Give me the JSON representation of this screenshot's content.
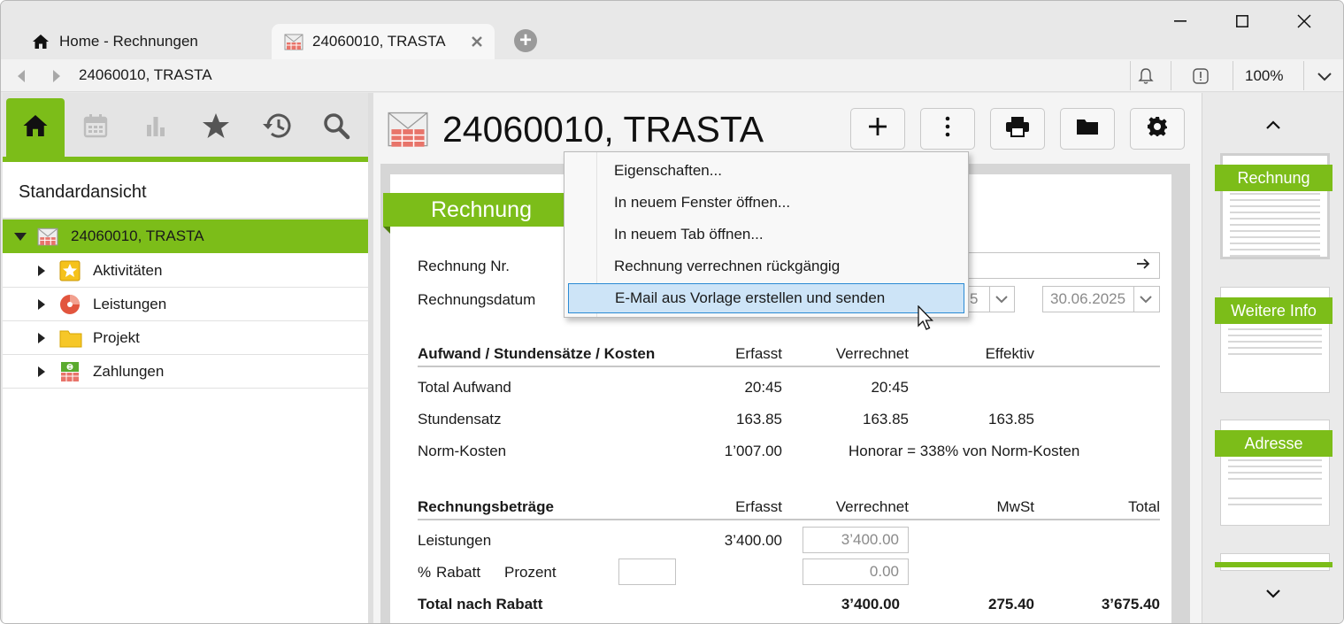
{
  "titlebar": {
    "tabs": [
      {
        "label": "Home - Rechnungen",
        "icon": "home-icon"
      },
      {
        "label": "24060010, TRASTA",
        "icon": "invoice-envelope-icon",
        "active": true
      }
    ]
  },
  "address": {
    "text": "24060010, TRASTA",
    "zoom": "100%"
  },
  "left_panel": {
    "view_title": "Standardansicht",
    "tree_root": "24060010, TRASTA",
    "tree_items": [
      {
        "label": "Aktivitäten",
        "icon": "activities-star-icon"
      },
      {
        "label": "Leistungen",
        "icon": "services-pie-icon"
      },
      {
        "label": "Projekt",
        "icon": "folder-icon"
      },
      {
        "label": "Zahlungen",
        "icon": "payments-icon"
      }
    ]
  },
  "main": {
    "title": "24060010, TRASTA",
    "section_banner": "Rechnung",
    "invoice_no_label": "Rechnung Nr.",
    "invoice_date_label": "Rechnungsdatum",
    "date_value_partial": "5",
    "date_value": "30.06.2025",
    "effort": {
      "headers": [
        "Aufwand / Stundensätze / Kosten",
        "Erfasst",
        "Verrechnet",
        "Effektiv"
      ],
      "rows": [
        {
          "label": "Total Aufwand",
          "erfasst": "20:45",
          "verrechnet": "20:45",
          "effektiv": ""
        },
        {
          "label": "Stundensatz",
          "erfasst": "163.85",
          "verrechnet": "163.85",
          "effektiv": "163.85"
        },
        {
          "label": "Norm-Kosten",
          "erfasst": "1’007.00",
          "note": "Honorar = 338% von Norm-Kosten"
        }
      ]
    },
    "amounts": {
      "headers": [
        "Rechnungsbeträge",
        "Erfasst",
        "Verrechnet",
        "MwSt",
        "Total"
      ],
      "leistungen_label": "Leistungen",
      "leistungen_erfasst": "3’400.00",
      "leistungen_verrechnet": "3’400.00",
      "rabatt_symbol": "%",
      "rabatt_label": "Rabatt",
      "prozent_label": "Prozent",
      "rabatt_value": "0.00",
      "total_label": "Total nach Rabatt",
      "total_verrechnet": "3’400.00",
      "total_mwst": "275.40",
      "total_total": "3’675.40"
    }
  },
  "context_menu": {
    "items": [
      "Eigenschaften...",
      "In neuem Fenster öffnen...",
      "In neuem Tab öffnen...",
      "Rechnung verrechnen rückgängig",
      "E-Mail aus Vorlage erstellen und senden"
    ],
    "highlighted_index": 4
  },
  "right_panel": {
    "thumbnails": [
      "Rechnung",
      "Weitere Info",
      "Adresse"
    ]
  },
  "colors": {
    "accent": "#7cbd19",
    "highlight": "#cde4f7",
    "highlight_border": "#2a8ad4"
  }
}
